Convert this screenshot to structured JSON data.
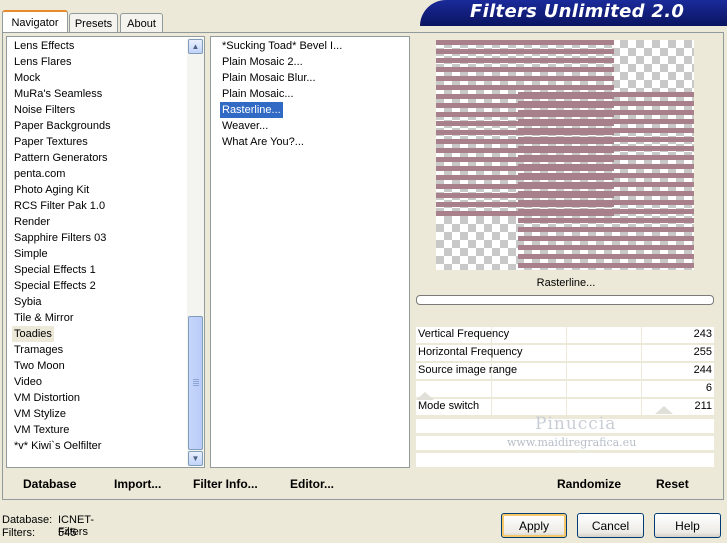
{
  "tabs": [
    "Navigator",
    "Presets",
    "About"
  ],
  "app_title": "Filters Unlimited 2.0",
  "categories": [
    "Lens Effects",
    "Lens Flares",
    "Mock",
    "MuRa's Seamless",
    "Noise Filters",
    "Paper Backgrounds",
    "Paper Textures",
    "Pattern Generators",
    "penta.com",
    "Photo Aging Kit",
    "RCS Filter Pak 1.0",
    "Render",
    "Sapphire Filters 03",
    "Simple",
    "Special Effects 1",
    "Special Effects 2",
    "Sybia",
    "Tile & Mirror",
    "Toadies",
    "Tramages",
    "Two Moon",
    "Video",
    "VM Distortion",
    "VM Stylize",
    "VM Texture",
    "*v* Kiwi`s Oelfilter"
  ],
  "selected_category": "Toadies",
  "filters": [
    "*Sucking Toad*  Bevel I...",
    "Plain Mosaic 2...",
    "Plain Mosaic Blur...",
    "Plain Mosaic...",
    "Rasterline...",
    "Weaver...",
    "What Are You?..."
  ],
  "selected_filter": "Rasterline...",
  "preview_label": "Rasterline...",
  "params": [
    {
      "name": "Vertical Frequency",
      "value": "243"
    },
    {
      "name": "Horizontal Frequency",
      "value": "255"
    },
    {
      "name": "Source image range",
      "value": "244"
    },
    {
      "name": "",
      "value": "6"
    },
    {
      "name": "Mode switch",
      "value": "211"
    }
  ],
  "watermark": {
    "line1": "Pinuccia",
    "line2": "www.maidiregrafica.eu"
  },
  "bottom_buttons": {
    "database": "Database",
    "import": "Import...",
    "filter_info": "Filter Info...",
    "editor": "Editor...",
    "randomize": "Randomize",
    "reset": "Reset"
  },
  "status": {
    "database_label": "Database:",
    "database_value": "ICNET-Filters",
    "filters_label": "Filters:",
    "filters_value": "545"
  },
  "dialog_buttons": {
    "apply": "Apply",
    "cancel": "Cancel",
    "help": "Help"
  },
  "colors": {
    "accent": "#316AC5",
    "banner": "#0B1460",
    "stripe": "#A8808C"
  }
}
